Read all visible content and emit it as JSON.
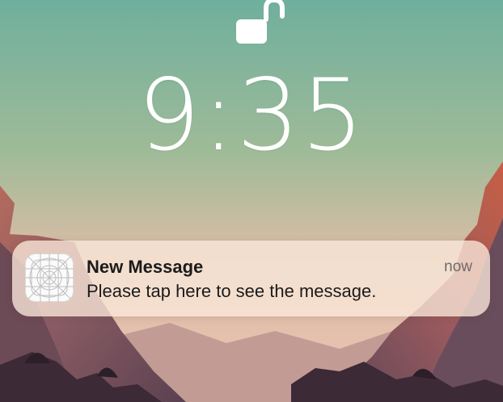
{
  "lockscreen": {
    "clock": "9:35"
  },
  "notification": {
    "title": "New Message",
    "body": "Please tap here to see the message.",
    "time": "now",
    "icon": "app-placeholder-icon"
  },
  "icons": {
    "lock": "unlocked-padlock-icon"
  },
  "colors": {
    "sky_top": "#6faf9d",
    "sky_horizon": "#efc4b3",
    "mountain": "#8b5c64",
    "notification_background": "#fae8da",
    "notification_text": "#1b1b1b",
    "time_text": "#6f6a68"
  }
}
